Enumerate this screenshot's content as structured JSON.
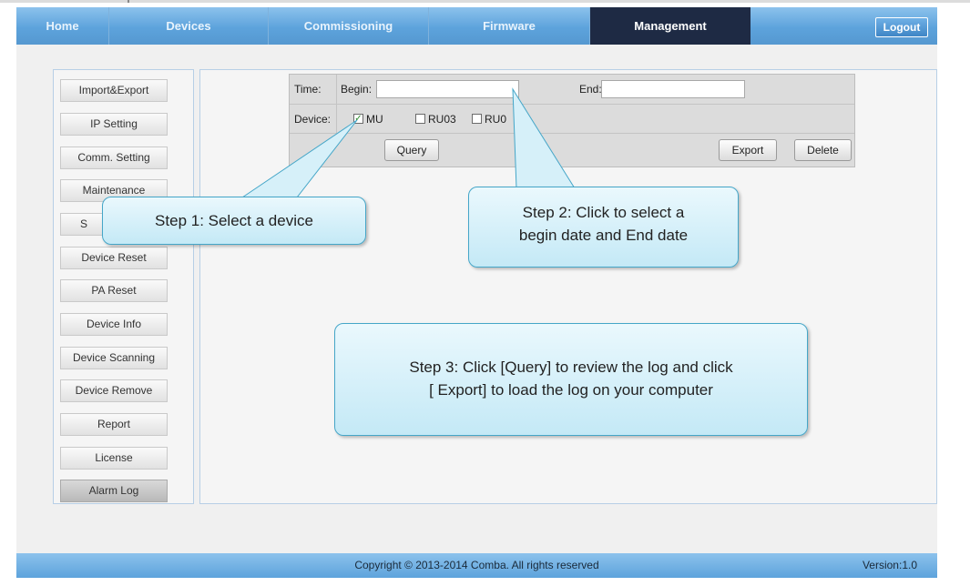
{
  "nav": {
    "tabs": [
      {
        "label": "Home"
      },
      {
        "label": "Devices"
      },
      {
        "label": "Commissioning"
      },
      {
        "label": "Firmware"
      },
      {
        "label": "Management"
      }
    ],
    "active_tab": "Management",
    "logout_label": "Logout"
  },
  "sidebar": {
    "items": [
      {
        "label": "Import&Export"
      },
      {
        "label": "IP Setting"
      },
      {
        "label": "Comm. Setting"
      },
      {
        "label": "Maintenance"
      },
      {
        "label": "S"
      },
      {
        "label": "Device Reset"
      },
      {
        "label": "PA Reset"
      },
      {
        "label": "Device Info"
      },
      {
        "label": "Device Scanning"
      },
      {
        "label": "Device Remove"
      },
      {
        "label": "Report"
      },
      {
        "label": "License"
      },
      {
        "label": "Alarm Log"
      }
    ],
    "active_item": "Alarm Log"
  },
  "form": {
    "time_label": "Time:",
    "begin_label": "Begin:",
    "begin_value": "",
    "end_label": "End:",
    "end_value": "",
    "device_label": "Device:",
    "devices": [
      {
        "label": "MU",
        "checked": true
      },
      {
        "label": "RU03",
        "checked": false
      },
      {
        "label": "RU0",
        "checked": false
      }
    ],
    "query_label": "Query",
    "export_label": "Export",
    "delete_label": "Delete"
  },
  "callouts": {
    "step1": "Step 1: Select a device",
    "step2_line1": "Step 2: Click to select a",
    "step2_line2": "begin date and End date",
    "step3_line1": "Step 3: Click [Query] to review the log and click",
    "step3_line2": "[ Export] to load the log on your computer"
  },
  "footer": {
    "copyright": "Copyright © 2013-2014 Comba. All rights reserved",
    "version": "Version:1.0"
  },
  "colors": {
    "nav_bar": "#5da3dc",
    "active_tab": "#1e2a44",
    "callout_fill": "#c4e9f6",
    "callout_border": "#45a6c8"
  }
}
